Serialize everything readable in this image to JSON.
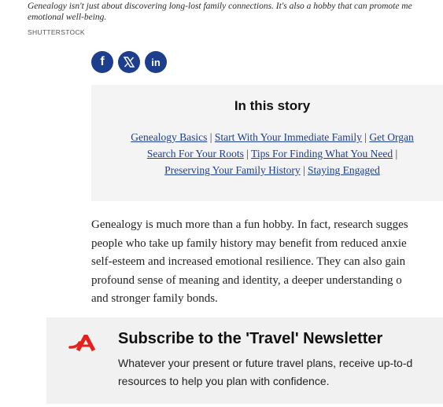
{
  "caption": {
    "text": "Genealogy isn't just about discovering long-lost family connections. It's also a hobby that can promote me\nemotional well-being.",
    "credit": "SHUTTERSTOCK"
  },
  "share": {
    "facebook_glyph": "f",
    "x_glyph": "𝕏",
    "linkedin_glyph": "in"
  },
  "story": {
    "title": "In this story",
    "links": [
      "Genealogy Basics",
      "Start With Your Immediate Family",
      "Get Organ",
      "Search For Your Roots",
      "Tips For Finding What You Need",
      "Preserving Your Family History",
      "Staying Engaged"
    ],
    "separator": " | "
  },
  "article": {
    "lines": [
      "Genealogy is much more than a fun hobby. In fact, research sugges",
      "people who take up family history may benefit from reduced anxie",
      "self-esteem and increased emotional resilience. They can also gain",
      "profound sense of meaning and identity, a deeper understanding o",
      "and stronger family bonds."
    ]
  },
  "newsletter": {
    "title": "Subscribe to the 'Travel' Newsletter",
    "desc_lines": [
      "Whatever your present or future travel plans, receive up-to-d",
      "resources to help you plan with confidence."
    ]
  },
  "colors": {
    "brand_navy": "#1d3e8c",
    "aarp_red": "#e4211b",
    "panel_bg": "#f4f4f4"
  }
}
